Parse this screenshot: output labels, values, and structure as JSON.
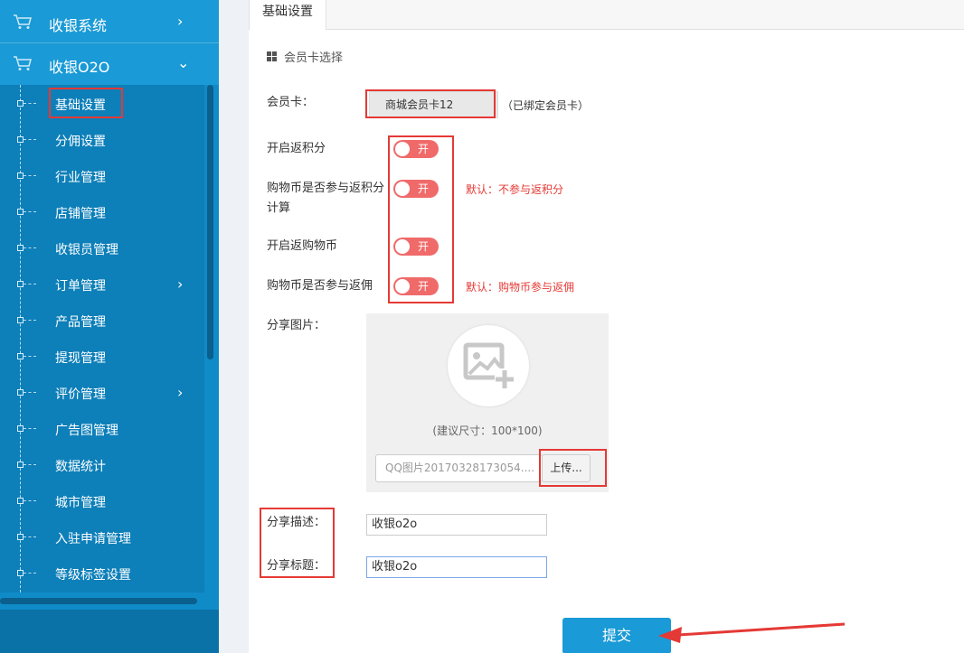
{
  "sidebar": {
    "headers": [
      {
        "label": "收银系统",
        "icon": "cart-icon",
        "chevron": "chevron-right-icon"
      },
      {
        "label": "收银O2O",
        "icon": "cart-icon",
        "chevron": "chevron-down-icon"
      }
    ],
    "items": [
      {
        "label": "基础设置"
      },
      {
        "label": "分佣设置"
      },
      {
        "label": "行业管理"
      },
      {
        "label": "店铺管理"
      },
      {
        "label": "收银员管理"
      },
      {
        "label": "订单管理"
      },
      {
        "label": "产品管理"
      },
      {
        "label": "提现管理"
      },
      {
        "label": "评价管理"
      },
      {
        "label": "广告图管理"
      },
      {
        "label": "数据统计"
      },
      {
        "label": "城市管理"
      },
      {
        "label": "入驻申请管理"
      },
      {
        "label": "等级标签设置"
      }
    ]
  },
  "main": {
    "tab": "基础设置",
    "section_title": "会员卡选择",
    "member_card_label": "会员卡：",
    "member_card_value": "商城会员卡12",
    "member_card_note": "（已绑定会员卡）",
    "toggles": [
      {
        "label": "开启返积分",
        "state": "开",
        "hint": ""
      },
      {
        "label": "购物币是否参与返积分计算",
        "state": "开",
        "hint": "默认：不参与返积分"
      },
      {
        "label": "开启返购物币",
        "state": "开",
        "hint": ""
      },
      {
        "label": "购物币是否参与返佣",
        "state": "开",
        "hint": "默认：购物币参与返佣"
      }
    ],
    "share_image_label": "分享图片：",
    "size_hint": "(建议尺寸：100*100)",
    "file_name": "QQ图片20170328173054....",
    "upload_label": "上传...",
    "share_desc_label": "分享描述：",
    "share_desc_value": "收银o2o",
    "share_title_label": "分享标题：",
    "share_title_value": "收银o2o",
    "submit_label": "提交"
  },
  "colors": {
    "sidebar": "#0f8bc8",
    "toggle_on": "#f06a6a",
    "hint_red": "#e53935",
    "submit": "#1a9ad6"
  }
}
